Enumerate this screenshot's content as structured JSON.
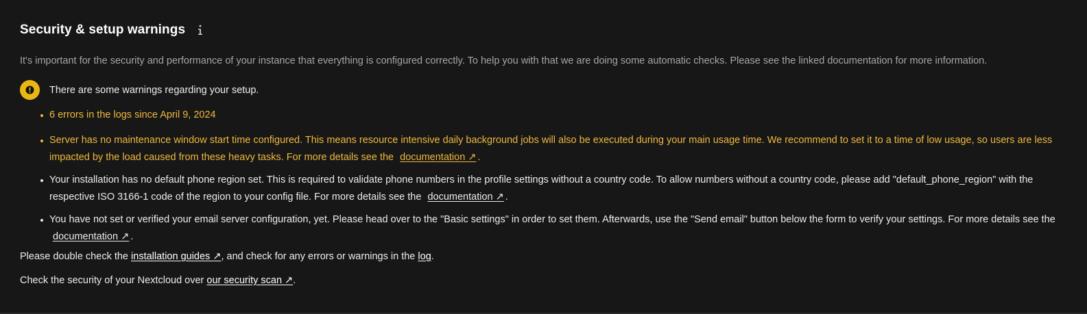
{
  "section": {
    "title": "Security & setup warnings",
    "intro": "It's important for the security and performance of your instance that everything is configured correctly. To help you with that we are doing some automatic checks. Please see the linked documentation for more information."
  },
  "warning_summary": "There are some warnings regarding your setup.",
  "warnings": [
    {
      "level": "warning",
      "text": "6 errors in the logs since April 9, 2024"
    },
    {
      "level": "warning",
      "text": "Server has no maintenance window start time configured. This means resource intensive daily background jobs will also be executed during your main usage time. We recommend to set it to a time of low usage, so users are less impacted by the load caused from these heavy tasks. For more details see the",
      "link": "documentation ↗",
      "after": "."
    },
    {
      "level": "info",
      "text": "Your installation has no default phone region set. This is required to validate phone numbers in the profile settings without a country code. To allow numbers without a country code, please add \"default_phone_region\" with the respective ISO 3166-1 code of the region to your config file. For more details see the",
      "link": "documentation ↗",
      "after": "."
    },
    {
      "level": "info",
      "text": "You have not set or verified your email server configuration, yet. Please head over to the \"Basic settings\" in order to set them. Afterwards, use the \"Send email\" button below the form to verify your settings. For more details see the",
      "link": "documentation ↗",
      "after": "."
    }
  ],
  "footer": {
    "line1_pre": "Please double check the ",
    "line1_link1": "installation guides ↗",
    "line1_mid": ", and check for any errors or warnings in the ",
    "line1_link2": "log",
    "line1_post": ".",
    "line2_pre": "Check the security of your Nextcloud over ",
    "line2_link": "our security scan ↗",
    "line2_post": "."
  },
  "colors": {
    "background": "#171717",
    "warning_text": "#f0b93c",
    "warning_badge": "#e9b714",
    "text": "#ececec",
    "muted": "#a6a6a6"
  },
  "icons": {
    "info": "info-icon",
    "warning": "alert-circle-icon"
  }
}
